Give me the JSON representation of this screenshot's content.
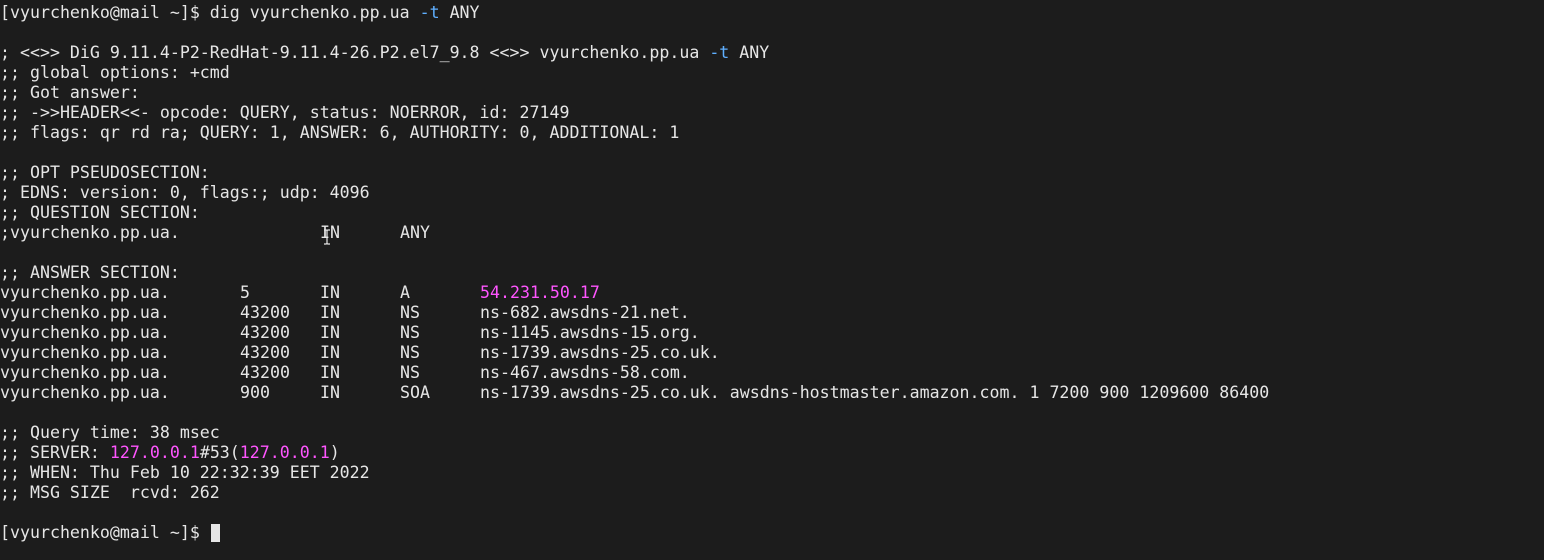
{
  "window": {
    "title": "Terminal"
  },
  "colors": {
    "background": "#1c1c1c",
    "foreground": "#e6e6e6",
    "option_flag": "#5fafff",
    "highlight": "#ff55ff"
  },
  "lines": [
    {
      "type": "plain",
      "segments": [
        {
          "text": "[vyurchenko@mail ~]$ dig vyurchenko.pp.ua "
        },
        {
          "text": "-t",
          "color": "#5fafff"
        },
        {
          "text": " ANY"
        }
      ]
    },
    {
      "type": "plain",
      "segments": [
        {
          "text": ""
        }
      ]
    },
    {
      "type": "plain",
      "segments": [
        {
          "text": "; <<>> DiG 9.11.4-P2-RedHat-9.11.4-26.P2.el7_9.8 <<>> vyurchenko.pp.ua "
        },
        {
          "text": "-t",
          "color": "#5fafff"
        },
        {
          "text": " ANY"
        }
      ]
    },
    {
      "type": "plain",
      "segments": [
        {
          "text": ";; global options: +cmd"
        }
      ]
    },
    {
      "type": "plain",
      "segments": [
        {
          "text": ";; Got answer:"
        }
      ]
    },
    {
      "type": "plain",
      "segments": [
        {
          "text": ";; ->>HEADER<<- opcode: QUERY, status: NOERROR, id: 27149"
        }
      ]
    },
    {
      "type": "plain",
      "segments": [
        {
          "text": ";; flags: qr rd ra; QUERY: 1, ANSWER: 6, AUTHORITY: 0, ADDITIONAL: 1"
        }
      ]
    },
    {
      "type": "plain",
      "segments": [
        {
          "text": ""
        }
      ]
    },
    {
      "type": "plain",
      "segments": [
        {
          "text": ";; OPT PSEUDOSECTION:"
        }
      ]
    },
    {
      "type": "plain",
      "segments": [
        {
          "text": "; EDNS: version: 0, flags:; udp: 4096"
        }
      ]
    },
    {
      "type": "plain",
      "segments": [
        {
          "text": ";; QUESTION SECTION:"
        }
      ]
    },
    {
      "type": "record",
      "cols": [
        {
          "text": ";vyurchenko.pp.ua."
        },
        {
          "text": ""
        },
        {
          "text": "IN"
        },
        {
          "text": "ANY"
        },
        {
          "text": ""
        }
      ]
    },
    {
      "type": "plain",
      "segments": [
        {
          "text": ""
        }
      ]
    },
    {
      "type": "plain",
      "segments": [
        {
          "text": ";; ANSWER SECTION:"
        }
      ]
    },
    {
      "type": "record",
      "cols": [
        {
          "text": "vyurchenko.pp.ua."
        },
        {
          "text": "5"
        },
        {
          "text": "IN"
        },
        {
          "text": "A"
        },
        {
          "text": "54.231.50.17",
          "color": "#ff55ff"
        }
      ]
    },
    {
      "type": "record",
      "cols": [
        {
          "text": "vyurchenko.pp.ua."
        },
        {
          "text": "43200"
        },
        {
          "text": "IN"
        },
        {
          "text": "NS"
        },
        {
          "text": "ns-682.awsdns-21.net."
        }
      ]
    },
    {
      "type": "record",
      "cols": [
        {
          "text": "vyurchenko.pp.ua."
        },
        {
          "text": "43200"
        },
        {
          "text": "IN"
        },
        {
          "text": "NS"
        },
        {
          "text": "ns-1145.awsdns-15.org."
        }
      ]
    },
    {
      "type": "record",
      "cols": [
        {
          "text": "vyurchenko.pp.ua."
        },
        {
          "text": "43200"
        },
        {
          "text": "IN"
        },
        {
          "text": "NS"
        },
        {
          "text": "ns-1739.awsdns-25.co.uk."
        }
      ]
    },
    {
      "type": "record",
      "cols": [
        {
          "text": "vyurchenko.pp.ua."
        },
        {
          "text": "43200"
        },
        {
          "text": "IN"
        },
        {
          "text": "NS"
        },
        {
          "text": "ns-467.awsdns-58.com."
        }
      ]
    },
    {
      "type": "record",
      "cols": [
        {
          "text": "vyurchenko.pp.ua."
        },
        {
          "text": "900"
        },
        {
          "text": "IN"
        },
        {
          "text": "SOA"
        },
        {
          "text": "ns-1739.awsdns-25.co.uk. awsdns-hostmaster.amazon.com. 1 7200 900 1209600 86400"
        }
      ]
    },
    {
      "type": "plain",
      "segments": [
        {
          "text": ""
        }
      ]
    },
    {
      "type": "plain",
      "segments": [
        {
          "text": ";; Query time: 38 msec"
        }
      ]
    },
    {
      "type": "plain",
      "segments": [
        {
          "text": ";; SERVER: "
        },
        {
          "text": "127.0.0.1",
          "color": "#ff55ff"
        },
        {
          "text": "#53("
        },
        {
          "text": "127.0.0.1",
          "color": "#ff55ff"
        },
        {
          "text": ")"
        }
      ]
    },
    {
      "type": "plain",
      "segments": [
        {
          "text": ";; WHEN: Thu Feb 10 22:32:39 EET 2022"
        }
      ]
    },
    {
      "type": "plain",
      "segments": [
        {
          "text": ";; MSG SIZE  rcvd: 262"
        }
      ]
    },
    {
      "type": "plain",
      "segments": [
        {
          "text": ""
        }
      ]
    },
    {
      "type": "prompt",
      "segments": [
        {
          "text": "[vyurchenko@mail ~]$ "
        }
      ]
    }
  ],
  "icons": {
    "cursor": "block-cursor-icon",
    "pointer": "ibeam-cursor-icon"
  }
}
